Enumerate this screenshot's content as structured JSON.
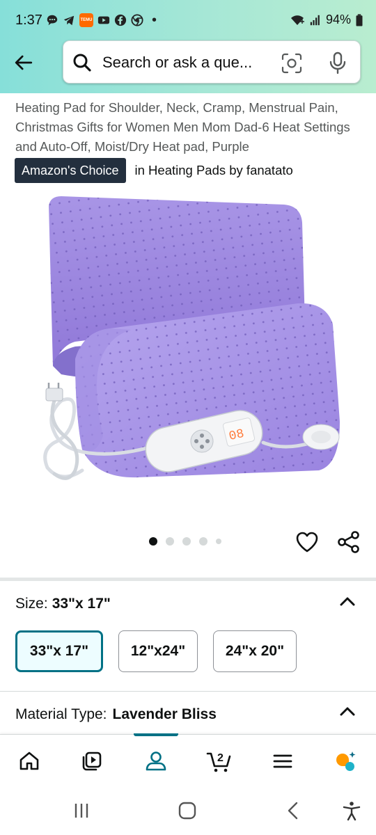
{
  "status_bar": {
    "time": "1:37",
    "battery": "94%",
    "temu_badge": "TEMU",
    "icons": [
      "chat-bubble-icon",
      "telegram-icon",
      "temu-icon",
      "youtube-icon",
      "facebook-icon",
      "chrome-icon",
      "wifi-icon",
      "signal-icon",
      "battery-icon"
    ]
  },
  "header": {
    "back_icon": "arrow-left-icon",
    "search": {
      "placeholder": "Search or ask a que...",
      "icons": [
        "search-icon",
        "camera-scan-icon",
        "microphone-icon"
      ]
    }
  },
  "product": {
    "title": "Heating Pad for Shoulder, Neck, Cramp, Menstrual Pain, Christmas Gifts for Women Men Mom Dad-6 Heat Settings and Auto-Off, Moist/Dry Heat pad, Purple",
    "badge": "Amazon's Choice",
    "badge_category": "in Heating Pads by fanatato",
    "controller_display": "08",
    "image_count": 5,
    "active_image_index": 0
  },
  "size": {
    "label": "Size:",
    "selected": "33\"x 17\"",
    "options": [
      "33\"x 17\"",
      "12\"x24\"",
      "24\"x 20\""
    ]
  },
  "material": {
    "label": "Material Type:",
    "selected": "Lavender Bliss"
  },
  "bottom_nav": {
    "items": [
      "home-icon",
      "inspire-play-icon",
      "account-icon",
      "cart-icon",
      "menu-icon",
      "rufus-icon"
    ],
    "cart_count": "2",
    "active_index": 2
  },
  "system_nav": [
    "recents-icon",
    "home-circle-icon",
    "back-icon",
    "accessibility-icon"
  ],
  "colors": {
    "header_gradient_start": "#86dfd9",
    "header_gradient_end": "#b9edd0",
    "teal_accent": "#007185",
    "badge_bg": "#232f3e",
    "product_purple": "#9b86e0"
  }
}
